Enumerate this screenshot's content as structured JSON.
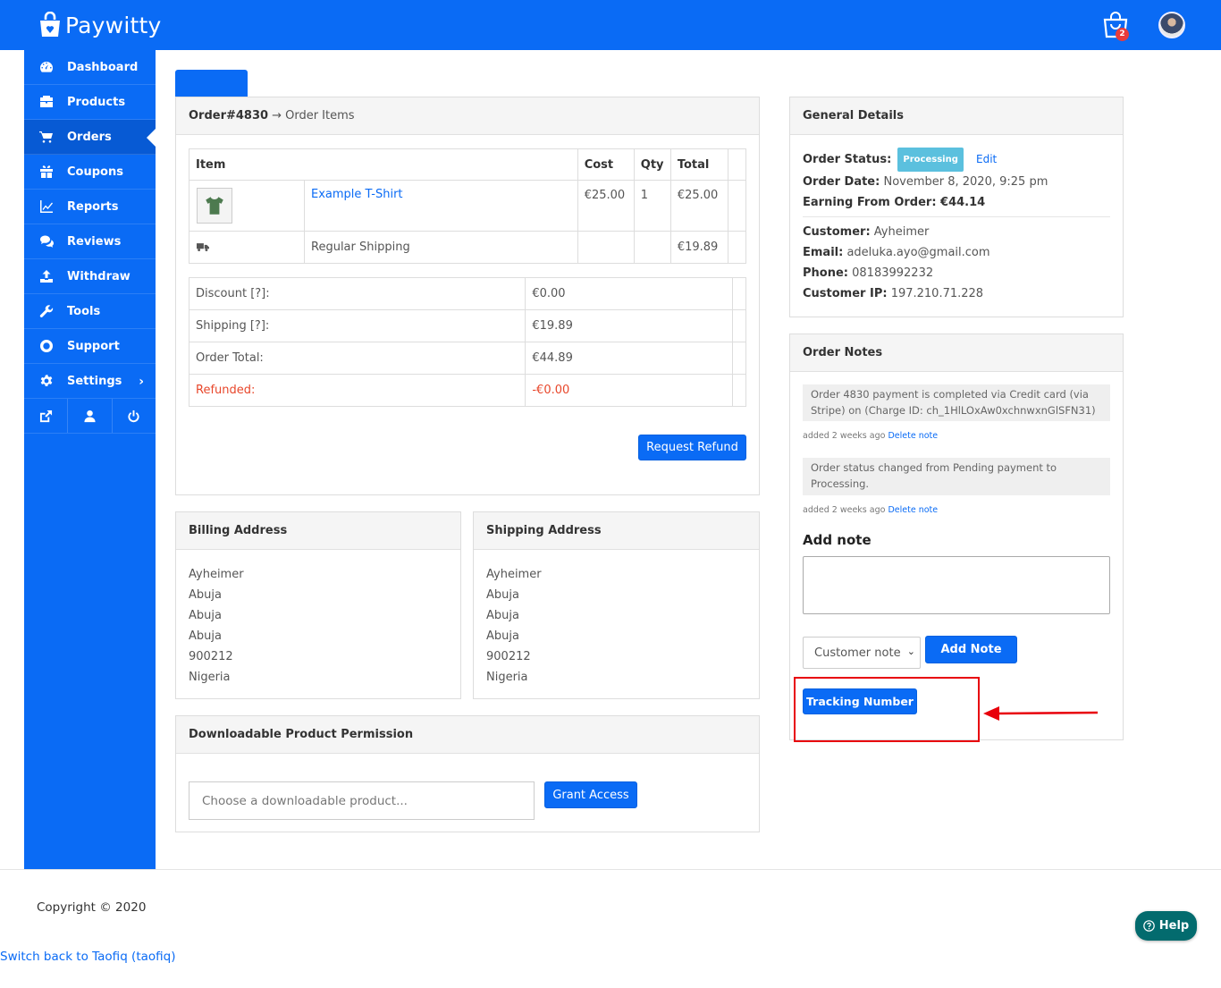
{
  "app": {
    "brand": "Paywitty",
    "cart_count": "2"
  },
  "sidebar": {
    "items": [
      {
        "label": "Dashboard",
        "icon": "dashboard-icon"
      },
      {
        "label": "Products",
        "icon": "briefcase-icon"
      },
      {
        "label": "Orders",
        "icon": "cart-icon",
        "active": true
      },
      {
        "label": "Coupons",
        "icon": "gift-icon"
      },
      {
        "label": "Reports",
        "icon": "line-chart-icon"
      },
      {
        "label": "Reviews",
        "icon": "comments-icon"
      },
      {
        "label": "Withdraw",
        "icon": "upload-icon"
      },
      {
        "label": "Tools",
        "icon": "wrench-icon"
      },
      {
        "label": "Support",
        "icon": "lifebuoy-icon"
      },
      {
        "label": "Settings",
        "icon": "gear-icon"
      }
    ],
    "bottom_icons": [
      "external-link-icon",
      "user-icon",
      "power-icon"
    ]
  },
  "order": {
    "title": "Order#4830",
    "subtitle": "→ Order Items",
    "columns": [
      "Item",
      "Cost",
      "Qty",
      "Total"
    ],
    "item": {
      "name": "Example T-Shirt",
      "cost": "€25.00",
      "qty": "1",
      "total": "€25.00"
    },
    "shipping": {
      "name": "Regular Shipping",
      "total": "€19.89"
    },
    "totals": [
      {
        "label": "Discount [?]:",
        "value": "€0.00"
      },
      {
        "label": "Shipping [?]:",
        "value": "€19.89"
      },
      {
        "label": "Order Total:",
        "value": "€44.89"
      },
      {
        "label": "Refunded:",
        "value": "-€0.00"
      }
    ],
    "refund_button": "Request Refund"
  },
  "billing": {
    "title": "Billing Address",
    "lines": [
      "Ayheimer",
      "Abuja",
      "Abuja",
      "Abuja",
      "900212",
      "Nigeria"
    ]
  },
  "shipping_address": {
    "title": "Shipping Address",
    "lines": [
      "Ayheimer",
      "Abuja",
      "Abuja",
      "Abuja",
      "900212",
      "Nigeria"
    ]
  },
  "downloadable": {
    "title": "Downloadable Product Permission",
    "placeholder": "Choose a downloadable product...",
    "button": "Grant Access"
  },
  "general": {
    "title": "General Details",
    "status_label": "Order Status:",
    "status": "Processing",
    "edit": "Edit",
    "date_label": "Order Date:",
    "date": "November 8, 2020, 9:25 pm",
    "earning": "Earning From Order: €44.14",
    "customer_label": "Customer:",
    "customer": "Ayheimer",
    "email_label": "Email:",
    "email": "adeluka.ayo@gmail.com",
    "phone_label": "Phone:",
    "phone": "08183992232",
    "ip_label": "Customer IP:",
    "ip": "197.210.71.228"
  },
  "notes": {
    "title": "Order Notes",
    "items": [
      {
        "text": "Order 4830 payment is completed via Credit card (via Stripe) on (Charge ID: ch_1HlLOxAw0xchnwxnGlSFN31)",
        "meta": "added 2 weeks ago",
        "delete": "Delete note"
      },
      {
        "text": "Order status changed from Pending payment to Processing.",
        "meta": "added 2 weeks ago",
        "delete": "Delete note"
      }
    ],
    "add_title": "Add note",
    "type_selected": "Customer note",
    "add_button": "Add Note",
    "tracking_button": "Tracking Number"
  },
  "annotation": {
    "highlight_color": "#e8000b"
  },
  "footer": {
    "copyright": "Copyright © 2020",
    "switch_back": "Switch back to Taofiq (taofiq)",
    "help": "Help"
  }
}
